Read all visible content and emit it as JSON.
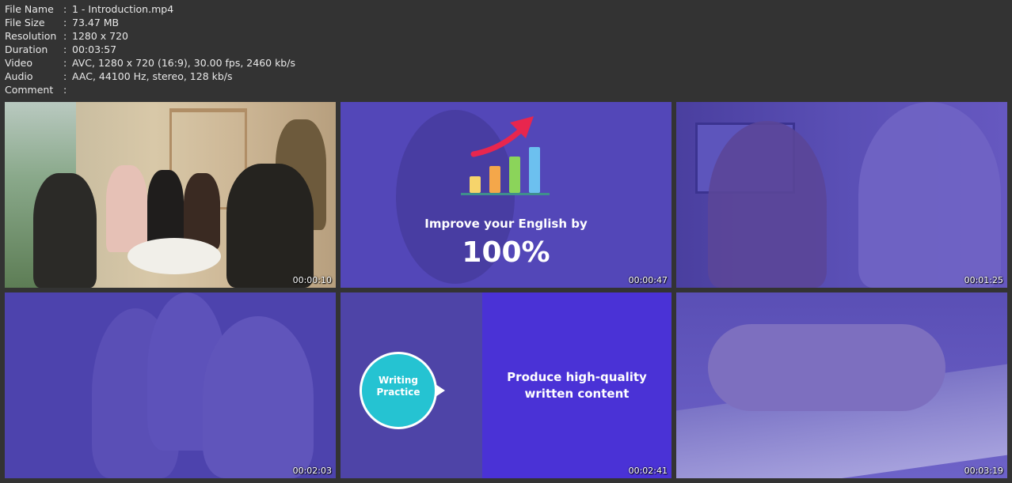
{
  "metadata": [
    {
      "key": "File Name",
      "value": "1 - Introduction.mp4"
    },
    {
      "key": "File Size",
      "value": "73.47 MB"
    },
    {
      "key": "Resolution",
      "value": "1280 x 720"
    },
    {
      "key": "Duration",
      "value": "00:03:57"
    },
    {
      "key": "Video",
      "value": "AVC, 1280 x 720 (16:9), 30.00 fps, 2460 kb/s"
    },
    {
      "key": "Audio",
      "value": "AAC, 44100 Hz, stereo, 128 kb/s"
    },
    {
      "key": "Comment",
      "value": ""
    }
  ],
  "separator": ":",
  "thumbnails": [
    {
      "timestamp": "00:00:10"
    },
    {
      "timestamp": "00:00:47",
      "headline": "Improve your English by",
      "big_text": "100%"
    },
    {
      "timestamp": "00:01:25"
    },
    {
      "timestamp": "00:02:03"
    },
    {
      "timestamp": "00:02:41",
      "bubble_line1": "Writing",
      "bubble_line2": "Practice",
      "caption_line1": "Produce high-quality",
      "caption_line2": "written content"
    },
    {
      "timestamp": "00:03:19"
    }
  ],
  "colors": {
    "background": "#333333",
    "slide_purple": "#5347b8",
    "accent_cyan": "#25c3d2",
    "arrow_red": "#e8264e"
  }
}
